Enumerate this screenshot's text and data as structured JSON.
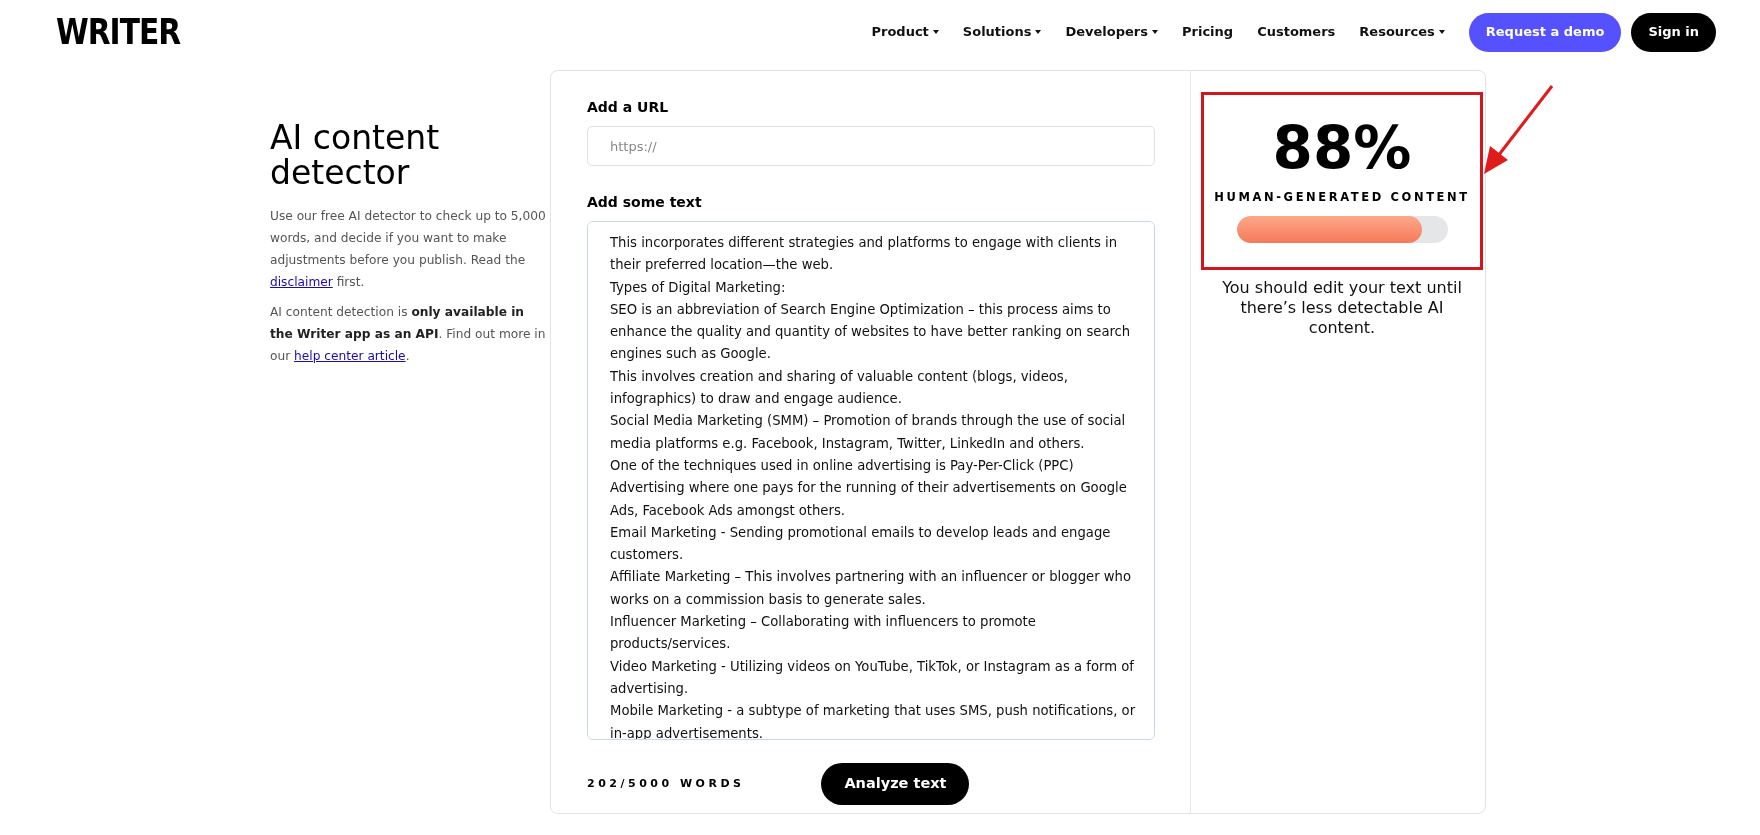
{
  "header": {
    "logo": "WRITER",
    "nav": [
      {
        "label": "Product",
        "kind": "dropdown"
      },
      {
        "label": "Solutions",
        "kind": "dropdown"
      },
      {
        "label": "Developers",
        "kind": "dropdown"
      },
      {
        "label": "Pricing",
        "kind": "link"
      },
      {
        "label": "Customers",
        "kind": "link"
      },
      {
        "label": "Resources",
        "kind": "dropdown"
      }
    ],
    "buttons": [
      {
        "label": "Request a demo",
        "kind": "primary"
      },
      {
        "label": "Sign in",
        "kind": "dark"
      }
    ]
  },
  "intro": {
    "title": "AI content detector",
    "paragraphs": [
      [
        {
          "kind": "text",
          "text": "Use our free AI detector to check up to 5,000 words, and decide if you want to make adjustments before you publish. Read the "
        },
        {
          "kind": "link",
          "text": "disclaimer"
        },
        {
          "kind": "text",
          "text": " first."
        }
      ],
      [
        {
          "kind": "text",
          "text": "AI content detection is **only available in the Writer app as an API**. Find out more in our "
        },
        {
          "kind": "link",
          "text": "help center article"
        },
        {
          "kind": "text",
          "text": "."
        }
      ]
    ]
  },
  "form": {
    "url_label": "Add a URL",
    "url_placeholder": "https://",
    "text_label": "Add some text",
    "text_lines": [
      "This incorporates different strategies and platforms to engage with clients in their preferred location—the web.",
      "Types of Digital Marketing:",
      "SEO is an abbreviation of Search Engine Optimization – this process aims to enhance the quality and quantity of websites to have better ranking on search engines such as Google.",
      "This involves creation and sharing of valuable content (blogs, videos, infographics) to draw and engage audience.",
      "Social Media Marketing (SMM) – Promotion of brands through the use of social media platforms e.g. Facebook, Instagram, Twitter, LinkedIn and others.",
      "One of the techniques used in online advertising is Pay-Per-Click (PPC)",
      "Advertising where one pays for the running of their advertisements on Google Ads, Facebook Ads amongst others.",
      "Email Marketing - Sending promotional emails to develop leads and engage customers.",
      "Affiliate Marketing – This involves partnering with an influencer or blogger who works on a commission basis to generate sales.",
      "Influencer Marketing – Collaborating with influencers to promote products/services.",
      "Video Marketing - Utilizing videos on YouTube, TikTok, or Instagram as a form of advertising.",
      "Mobile Marketing - a subtype of marketing that uses SMS, push notifications, or in-app advertisements."
    ],
    "word_count": "202/5000 WORDS",
    "analyze_button": "Analyze text"
  },
  "result": {
    "percent": "88%",
    "caption": "HUMAN-GENERATED CONTENT",
    "level": 0.88,
    "highlighted": true,
    "advice": "You should edit your text until there’s less detectable AI content."
  }
}
